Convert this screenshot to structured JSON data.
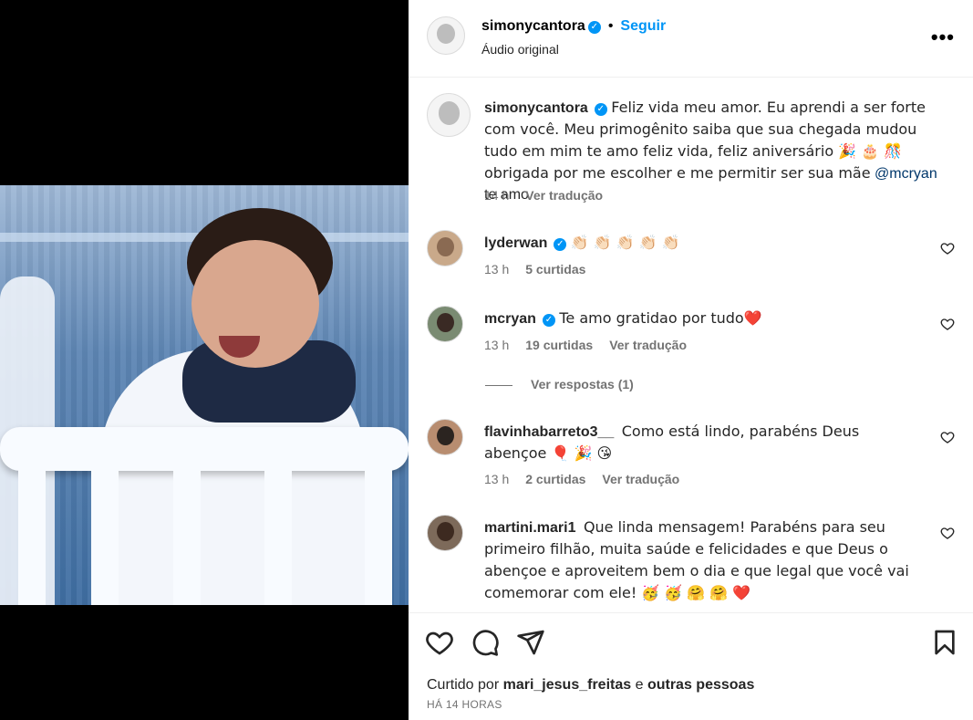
{
  "header": {
    "username": "simonycantora",
    "follow_label": "Seguir",
    "subtitle": "Áudio original",
    "separator": "•",
    "more": "•••"
  },
  "caption": {
    "username": "simonycantora",
    "text_before": "Feliz vida meu amor. Eu aprendi a ser forte com você. Meu primogênito saiba que sua chegada mudou tudo em mim te amo feliz vida, feliz aniversário 🎉 🎂 🎊 obrigada por me escolher e me permitir ser sua mãe",
    "mention": "@mcryan",
    "text_after": "te amo",
    "time": "14 h",
    "translate": "Ver tradução"
  },
  "comments": [
    {
      "username": "lyderwan",
      "verified": true,
      "text": "👏🏻 👏🏻 👏🏻 👏🏻 👏🏻",
      "time": "13 h",
      "likes": "5 curtidas",
      "translate": ""
    },
    {
      "username": "mcryan",
      "verified": true,
      "text": "Te amo gratidao por tudo❤️",
      "time": "13 h",
      "likes": "19 curtidas",
      "translate": "Ver tradução",
      "replies": "Ver respostas (1)"
    },
    {
      "username": "flavinhabarreto3__",
      "verified": false,
      "text": "Como está lindo, parabéns Deus abençoe 🎈 🎉 😘",
      "time": "13 h",
      "likes": "2 curtidas",
      "translate": "Ver tradução"
    },
    {
      "username": "martini.mari1",
      "verified": false,
      "text": "Que linda mensagem! Parabéns para seu primeiro filhão, muita saúde e felicidades e que Deus o abençoe e aproveitem bem o dia e que legal que você vai comemorar com ele! 🥳 🥳 🤗 🤗 ❤️"
    }
  ],
  "footer": {
    "liked_by_prefix": "Curtido por",
    "liked_by_user": "mari_jesus_freitas",
    "liked_by_and": "e",
    "liked_by_others": "outras pessoas",
    "timestamp": "HÁ 14 HORAS"
  },
  "icons": {
    "verified": "verified-badge-icon",
    "like": "heart-icon",
    "comment": "comment-icon",
    "share": "share-icon",
    "save": "bookmark-icon",
    "more": "more-options-icon"
  },
  "colors": {
    "accent": "#0095f6",
    "muted": "#737373",
    "mention": "#00376b"
  }
}
